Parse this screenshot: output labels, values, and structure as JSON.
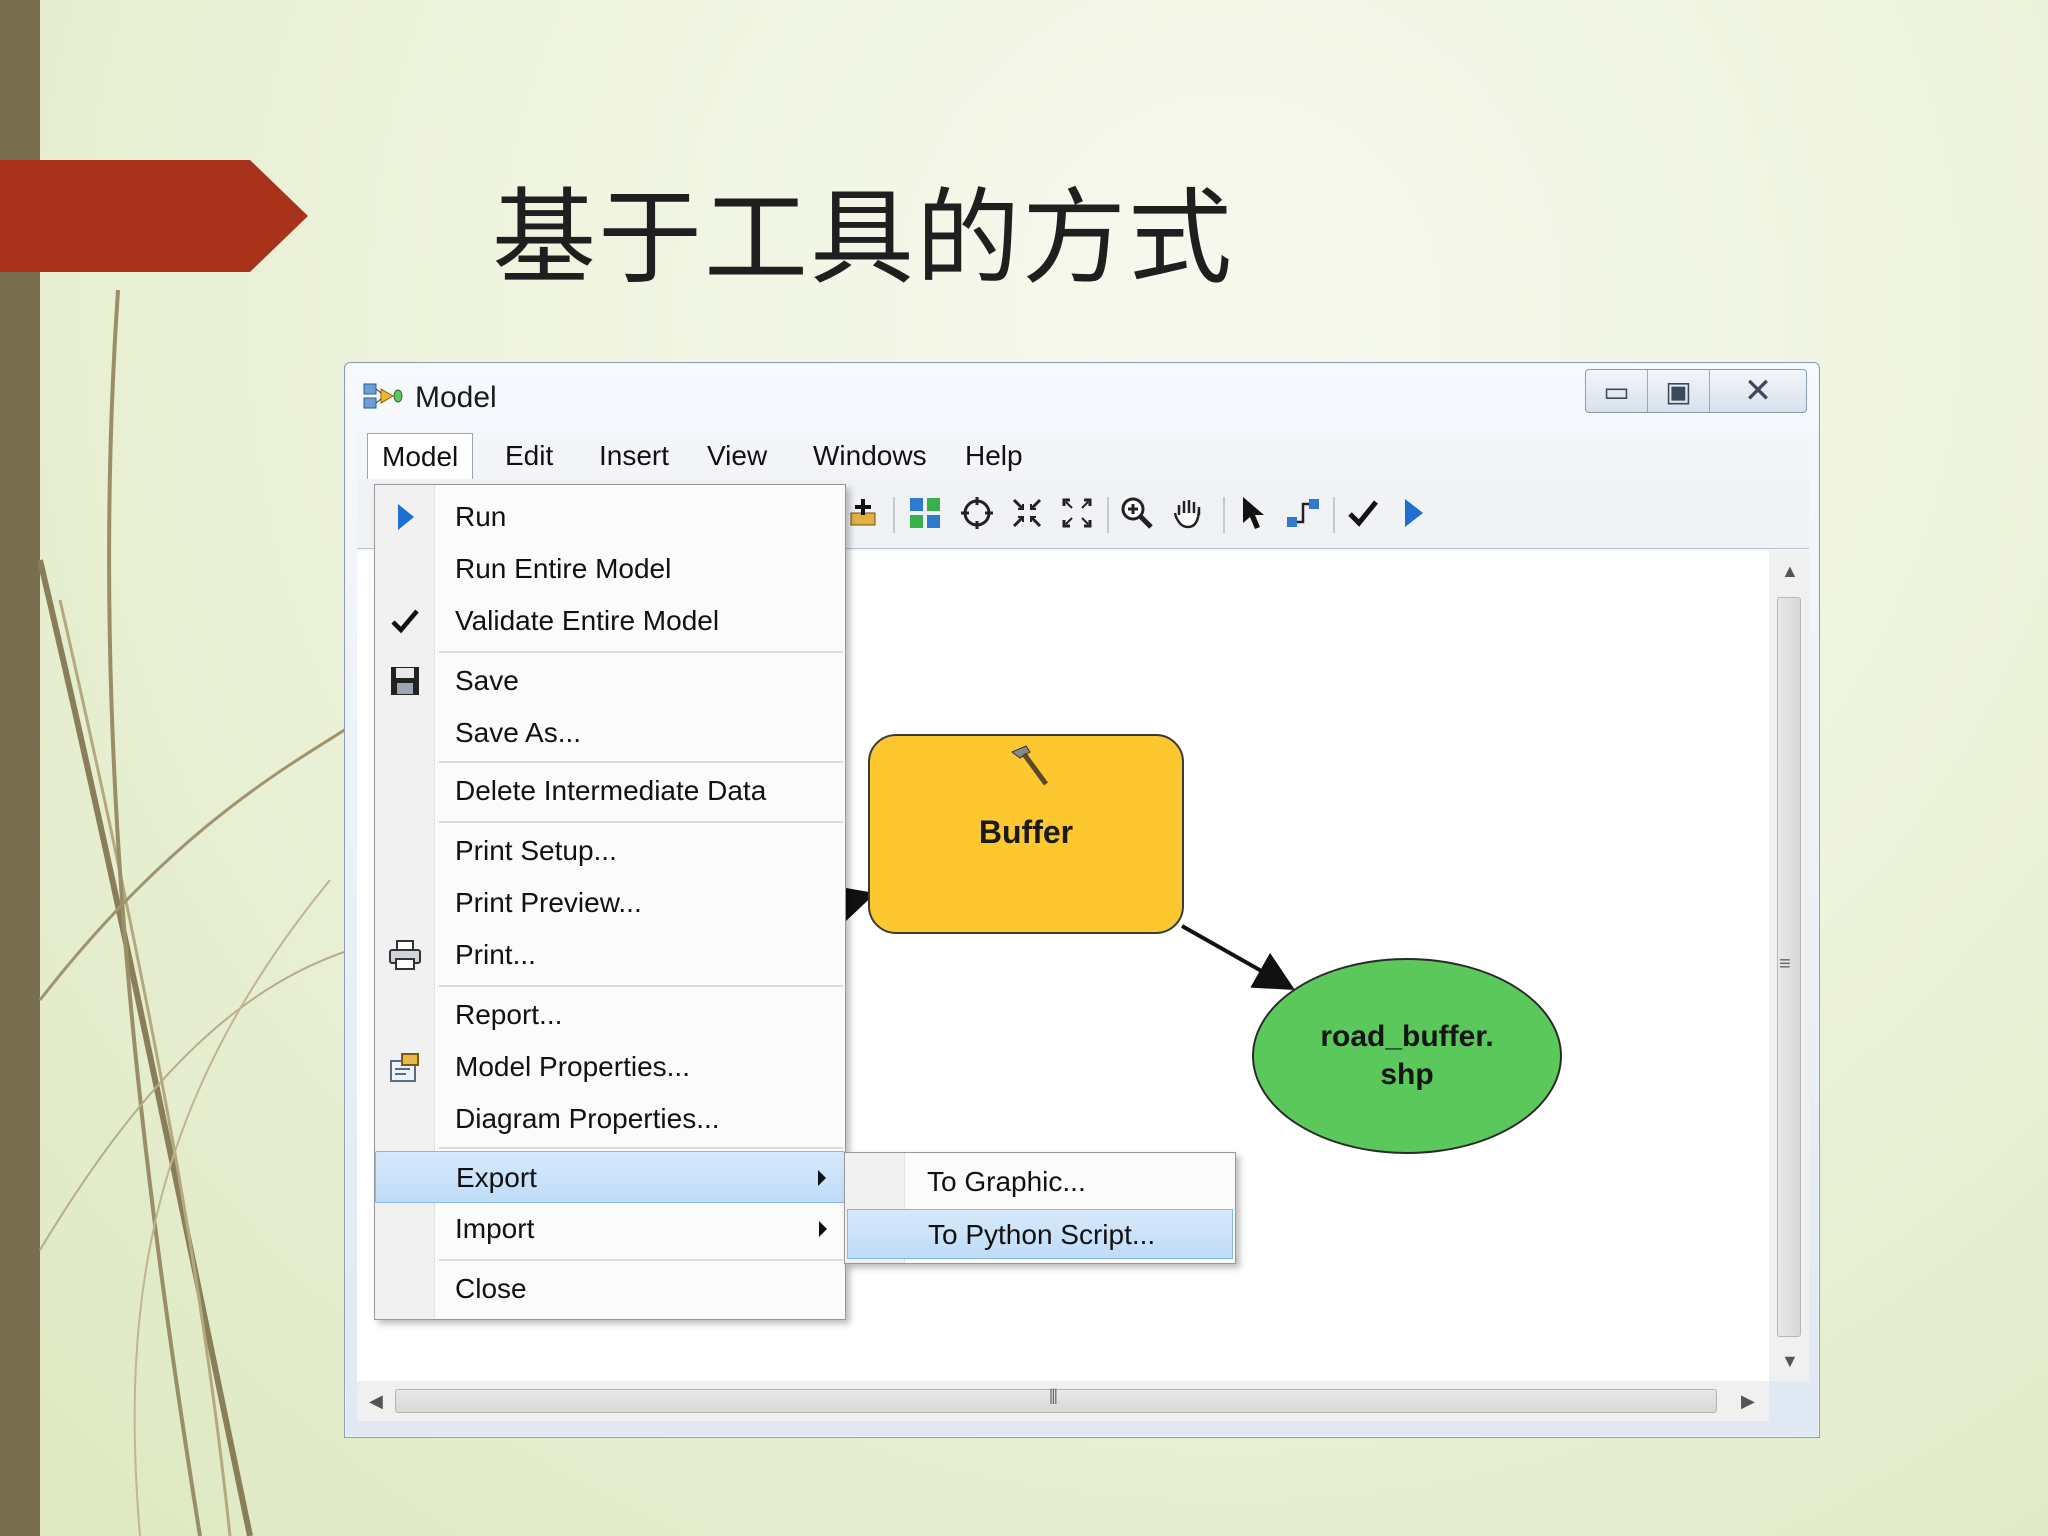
{
  "slide": {
    "title": "基于工具的方式"
  },
  "window": {
    "title": "Model",
    "controls": {
      "minimize": "▭",
      "maximize": "▣",
      "close": "✕"
    }
  },
  "menubar": {
    "items": [
      {
        "label": "Model"
      },
      {
        "label": "Edit"
      },
      {
        "label": "Insert"
      },
      {
        "label": "View"
      },
      {
        "label": "Windows"
      },
      {
        "label": "Help"
      }
    ]
  },
  "model_menu": {
    "items": [
      {
        "label": "Run",
        "icon": "run-icon"
      },
      {
        "label": "Run Entire Model"
      },
      {
        "label": "Validate Entire Model",
        "icon": "check-icon"
      },
      {
        "label": "Save",
        "icon": "floppy-icon"
      },
      {
        "label": "Save As..."
      },
      {
        "label": "Delete Intermediate Data"
      },
      {
        "label": "Print Setup..."
      },
      {
        "label": "Print Preview..."
      },
      {
        "label": "Print...",
        "icon": "printer-icon"
      },
      {
        "label": "Report..."
      },
      {
        "label": "Model Properties...",
        "icon": "properties-icon"
      },
      {
        "label": "Diagram Properties..."
      },
      {
        "label": "Export",
        "highlighted": true,
        "submenu": true
      },
      {
        "label": "Import",
        "submenu": true
      },
      {
        "label": "Close"
      }
    ]
  },
  "export_submenu": {
    "items": [
      {
        "label": "To Graphic..."
      },
      {
        "label": "To Python Script...",
        "highlighted": true
      }
    ]
  },
  "diagram": {
    "tool_node": {
      "label": "Buffer",
      "color": "#fdc72f"
    },
    "output_node": {
      "line1": "road_buffer.",
      "line2": "shp",
      "color": "#5bc85b"
    }
  },
  "colors": {
    "accent_banner": "#a8321a",
    "menu_highlight": "#c7e0f9",
    "left_bar": "#7a6e50"
  }
}
